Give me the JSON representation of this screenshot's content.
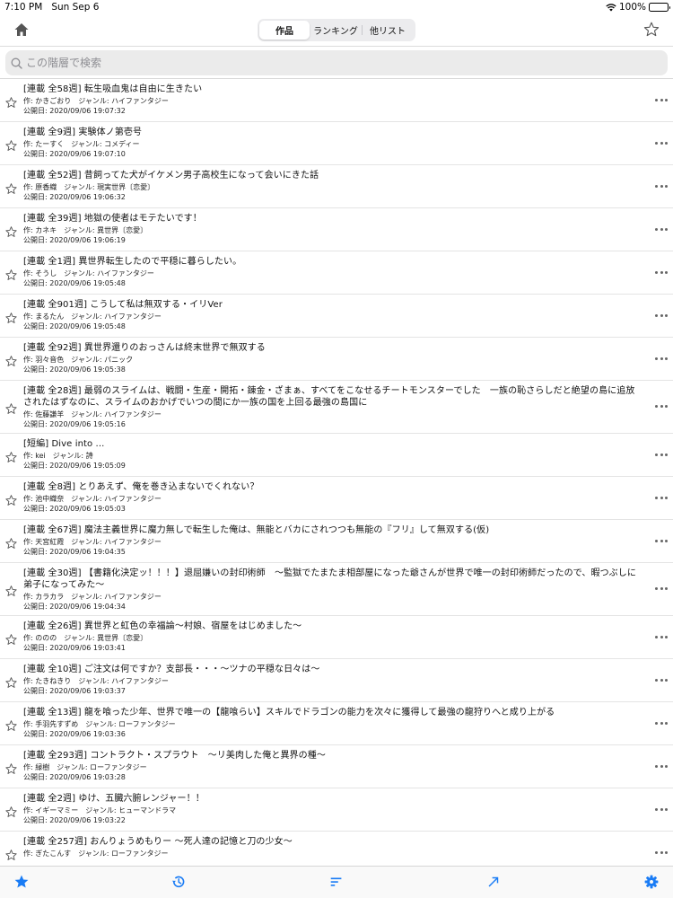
{
  "status_bar": {
    "time": "7:10 PM",
    "date": "Sun Sep 6",
    "battery": "100%",
    "battery_level_percent": 100,
    "wifi_icon": "wifi-icon"
  },
  "nav": {
    "home_icon": "home-icon",
    "favorite_icon": "star-outline-icon",
    "segments": [
      {
        "label": "作品",
        "active": true
      },
      {
        "label": "ランキング",
        "active": false
      },
      {
        "label": "他リスト",
        "active": false
      }
    ]
  },
  "search": {
    "placeholder": "この階層で検索",
    "value": ""
  },
  "labels": {
    "author_prefix": "作: ",
    "genre_prefix": "ジャンル: ",
    "date_prefix": "公開日: "
  },
  "works": [
    {
      "title": "[連載 全58週] 転生吸血鬼は自由に生きたい",
      "author": "かきごおり",
      "genre": "ハイファンタジー",
      "date": "2020/09/06 19:07:32"
    },
    {
      "title": "[連載 全9週] 実験体ノ第壱号",
      "author": "たーすく",
      "genre": "コメディー",
      "date": "2020/09/06 19:07:10"
    },
    {
      "title": "[連載 全52週] 昔飼ってた犬がイケメン男子高校生になって会いにきた話",
      "author": "原香織",
      "genre": "現実世界〔恋愛〕",
      "date": "2020/09/06 19:06:32"
    },
    {
      "title": "[連載 全39週] 地獄の使者はモテたいです！",
      "author": "カネキ",
      "genre": "異世界〔恋愛〕",
      "date": "2020/09/06 19:06:19"
    },
    {
      "title": "[連載 全1週] 異世界転生したので平穏に暮らしたい。",
      "author": "そうし",
      "genre": "ハイファンタジー",
      "date": "2020/09/06 19:05:48"
    },
    {
      "title": "[連載 全901週] こうして私は無双する・イリVer",
      "author": "まるたん",
      "genre": "ハイファンタジー",
      "date": "2020/09/06 19:05:48"
    },
    {
      "title": "[連載 全92週] 異世界還りのおっさんは終末世界で無双する",
      "author": "羽々音色",
      "genre": "パニック",
      "date": "2020/09/06 19:05:38"
    },
    {
      "title": "[連載 全28週] 最弱のスライムは、戦闘・生産・開拓・錬金・ざまぁ、すべてをこなせるチートモンスターでした　一族の恥さらしだと絶望の島に追放されたはずなのに、スライムのおかげでいつの間にか一族の国を上回る最強の島国に",
      "author": "佐藤謙羊",
      "genre": "ハイファンタジー",
      "date": "2020/09/06 19:05:16"
    },
    {
      "title": "[短編] Dive into ...",
      "author": "kei",
      "genre": "詩",
      "date": "2020/09/06 19:05:09"
    },
    {
      "title": "[連載 全8週] とりあえず、俺を巻き込まないでくれない？",
      "author": "池中織奈",
      "genre": "ハイファンタジー",
      "date": "2020/09/06 19:05:03"
    },
    {
      "title": "[連載 全67週] 魔法主義世界に魔力無しで転生した俺は、無能とバカにされつつも無能の『フリ』して無双する(仮)",
      "author": "天宮紅霞",
      "genre": "ハイファンタジー",
      "date": "2020/09/06 19:04:35"
    },
    {
      "title": "[連載 全30週] 【書籍化決定ッ！！！】退屈嫌いの封印術師　～監獄でたまたま相部屋になった爺さんが世界で唯一の封印術師だったので、暇つぶしに弟子になってみた～",
      "author": "カラカラ",
      "genre": "ハイファンタジー",
      "date": "2020/09/06 19:04:34"
    },
    {
      "title": "[連載 全26週] 異世界と虹色の幸福論～村娘、宿屋をはじめました～",
      "author": "ののの",
      "genre": "異世界〔恋愛〕",
      "date": "2020/09/06 19:03:41"
    },
    {
      "title": "[連載 全10週] ご注文は何ですか？支部長・・・～ツナの平穏な日々は～",
      "author": "たきねきり",
      "genre": "ハイファンタジー",
      "date": "2020/09/06 19:03:37"
    },
    {
      "title": "[連載 全13週] 龍を喰った少年、世界で唯一の【龍喰らい】スキルでドラゴンの能力を次々に獲得して最強の龍狩りへと成り上がる",
      "author": "手羽先すずめ",
      "genre": "ローファンタジー",
      "date": "2020/09/06 19:03:36"
    },
    {
      "title": "[連載 全293週] コントラクト・スプラウト　～リ美肉した俺と異界の種～",
      "author": "緑樹",
      "genre": "ローファンタジー",
      "date": "2020/09/06 19:03:28"
    },
    {
      "title": "[連載 全2週] ゆけ、五臓六腑レンジャー！！",
      "author": "イギーマミー",
      "genre": "ヒューマンドラマ",
      "date": "2020/09/06 19:03:22"
    },
    {
      "title": "[連載 全257週] おんりょうめもりー ～死人達の記憶と刀の少女～",
      "author": "ぎたこんす",
      "genre": "ローファンタジー",
      "date": ""
    }
  ],
  "tab_bar": {
    "accent_color": "#1a7cf5",
    "items": [
      {
        "icon": "star-filled-icon",
        "name": "favorites"
      },
      {
        "icon": "history-icon",
        "name": "history"
      },
      {
        "icon": "sort-icon",
        "name": "sort"
      },
      {
        "icon": "external-link-arrow-icon",
        "name": "open"
      },
      {
        "icon": "gear-icon",
        "name": "settings"
      }
    ]
  }
}
